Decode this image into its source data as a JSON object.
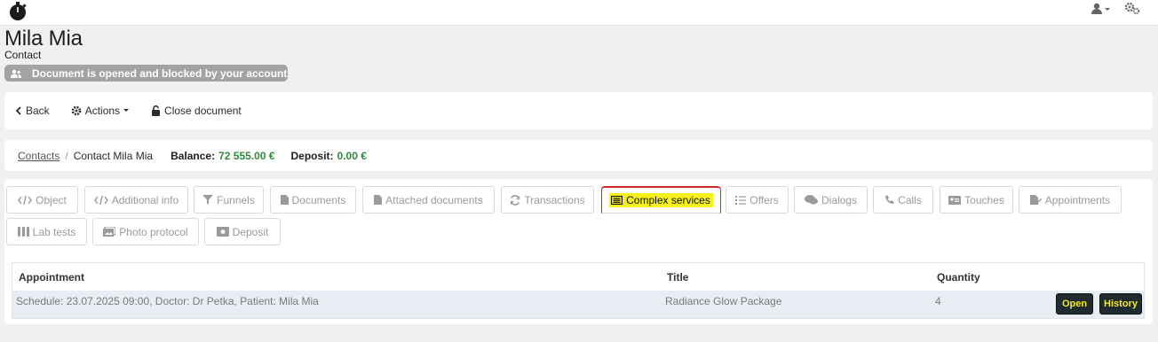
{
  "header": {
    "logo": "stopwatch-logo",
    "user_icon": "user-icon",
    "settings_icon": "gears-icon"
  },
  "record": {
    "name": "Mila Mia",
    "type": "Contact",
    "lock_message": "Document is opened and blocked by your account"
  },
  "toolbar": {
    "back": "Back",
    "actions": "Actions",
    "close": "Close document"
  },
  "breadcrumb": {
    "root": "Contacts",
    "current": "Contact Mila Mia",
    "balance_label": "Balance:",
    "balance_value": "72 555.00 €",
    "deposit_label": "Deposit:",
    "deposit_value": "0.00 €"
  },
  "tabs": [
    {
      "label": "Object",
      "icon": "code-icon"
    },
    {
      "label": "Additional info",
      "icon": "code-icon"
    },
    {
      "label": "Funnels",
      "icon": "filter-icon"
    },
    {
      "label": "Documents",
      "icon": "file-icon"
    },
    {
      "label": "Attached documents",
      "icon": "file-icon"
    },
    {
      "label": "Transactions",
      "icon": "refresh-icon"
    },
    {
      "label": "Complex services",
      "icon": "list-icon",
      "active": true
    },
    {
      "label": "Offers",
      "icon": "list-icon"
    },
    {
      "label": "Dialogs",
      "icon": "comments-icon"
    },
    {
      "label": "Calls",
      "icon": "phone-icon"
    },
    {
      "label": "Touches",
      "icon": "id-card-icon"
    },
    {
      "label": "Appointments",
      "icon": "edit-file-icon"
    },
    {
      "label": "Lab tests",
      "icon": "flask-icon"
    },
    {
      "label": "Photo protocol",
      "icon": "images-icon"
    },
    {
      "label": "Deposit",
      "icon": "money-icon"
    }
  ],
  "table": {
    "headers": [
      "Appointment",
      "Title",
      "Quantity"
    ],
    "rows": [
      {
        "appointment": "Schedule: 23.07.2025 09:00, Doctor: Dr Petka, Patient: Mila Mia",
        "title": "Radiance Glow Package",
        "quantity": "4",
        "open": "Open",
        "history": "History"
      }
    ]
  },
  "colors": {
    "accent_green": "#2e8b3a",
    "active_tab_border": "#d12a2a",
    "highlight": "#f5ef1c",
    "button_bg": "#1f2b2f",
    "button_text": "#f4e924"
  }
}
